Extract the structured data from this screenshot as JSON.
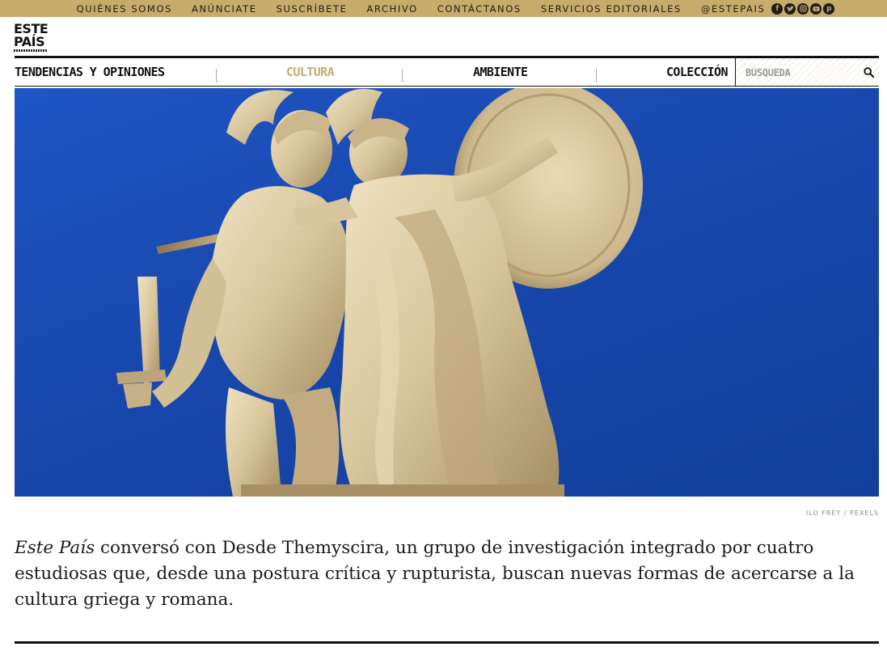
{
  "topbar": {
    "links": [
      "QUIÉNES SOMOS",
      "ANÚNCIATE",
      "SUSCRÍBETE",
      "ARCHIVO",
      "CONTÁCTANOS",
      "SERVICIOS EDITORIALES",
      "@ESTEPAIS"
    ],
    "social_icons": [
      "facebook-icon",
      "twitter-icon",
      "instagram-icon",
      "youtube-icon",
      "pinterest-icon"
    ],
    "background": "#c6ac6a"
  },
  "logo": {
    "line1": "ESTE",
    "line2": "PAÍS"
  },
  "nav": {
    "items": [
      {
        "label": "TENDENCIAS Y OPINIONES",
        "active": false
      },
      {
        "label": "CULTURA",
        "active": true
      },
      {
        "label": "AMBIENTE",
        "active": false
      },
      {
        "label": "COLECCIÓN",
        "active": false
      }
    ],
    "search_placeholder": "BÚSQUEDA",
    "accent": "#c6ac6a"
  },
  "hero": {
    "description": "marble statue of warrior and Athena against blue sky",
    "credit": "ILO FREY / PEXELS"
  },
  "article": {
    "lead_emphasis": "Este País",
    "lead_text": " conversó con Desde Themyscira, un grupo de investigación integrado por cuatro estudiosas que, desde una postura crítica y rupturista, buscan nuevas formas de acercarse a la cultura griega y romana."
  }
}
